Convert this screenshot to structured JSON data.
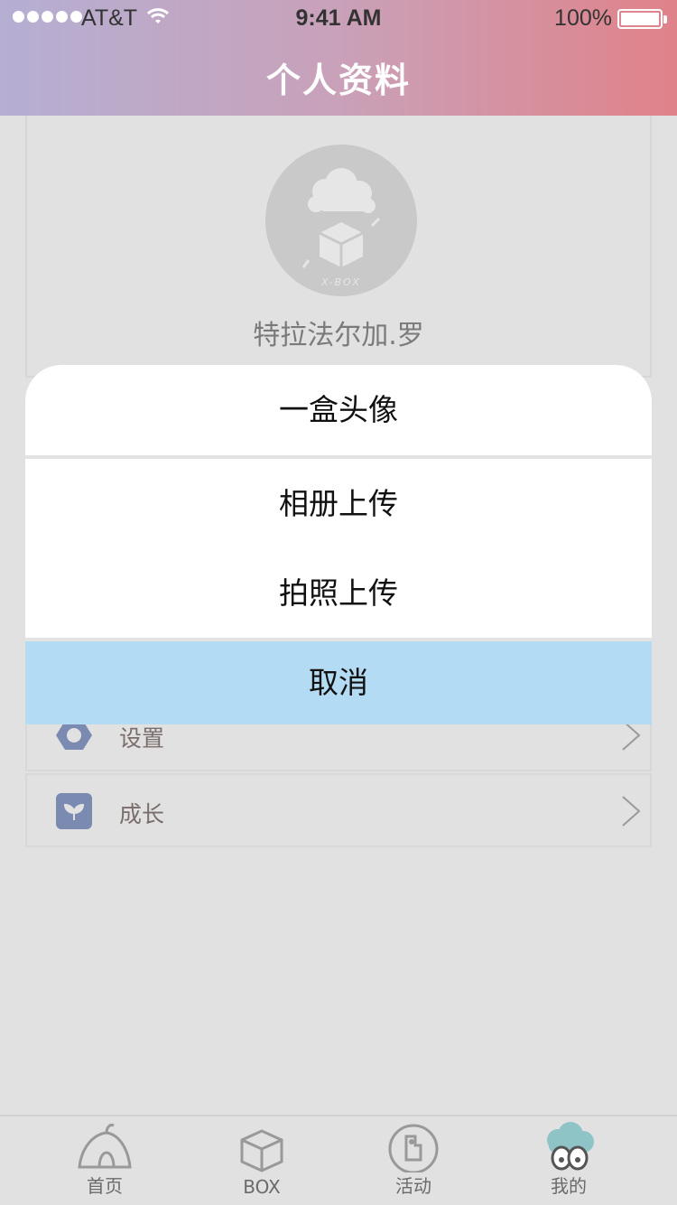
{
  "status_bar": {
    "carrier": "AT&T",
    "time": "9:41 AM",
    "battery": "100%"
  },
  "header": {
    "title": "个人资料"
  },
  "profile": {
    "username": "特拉法尔加.罗",
    "avatar_caption": "X-BOX"
  },
  "menu": {
    "items": [
      {
        "label": "设置",
        "icon": "hexagon-settings-icon"
      },
      {
        "label": "成长",
        "icon": "sprout-icon"
      }
    ]
  },
  "action_sheet": {
    "options": [
      "一盒头像",
      "相册上传",
      "拍照上传"
    ],
    "cancel": "取消"
  },
  "tab_bar": {
    "tabs": [
      {
        "label": "首页",
        "icon": "house-tent-icon"
      },
      {
        "label": "BOX",
        "icon": "box-icon"
      },
      {
        "label": "活动",
        "icon": "activity-icon"
      },
      {
        "label": "我的",
        "icon": "cloud-eyes-icon"
      }
    ]
  },
  "colors": {
    "header_gradient_start": "#b5afd3",
    "header_gradient_end": "#e08289",
    "cancel_bg": "#b3dcf4",
    "icon_blue": "#7b8ab0"
  }
}
